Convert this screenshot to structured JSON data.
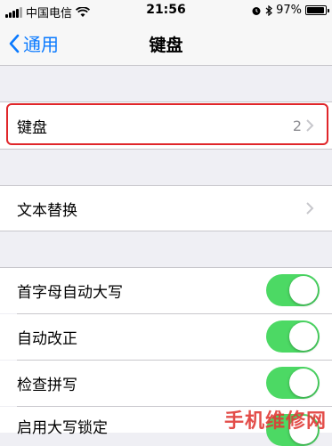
{
  "status_bar": {
    "carrier": "中国电信",
    "time": "21:56",
    "battery_percent": "97%",
    "battery_level": 0.97
  },
  "nav": {
    "back_label": "通用",
    "title": "键盘"
  },
  "rows": {
    "keyboards": {
      "label": "键盘",
      "value": "2"
    },
    "text_replacement": {
      "label": "文本替换"
    }
  },
  "toggles": [
    {
      "label": "首字母自动大写",
      "on": true
    },
    {
      "label": "自动改正",
      "on": true
    },
    {
      "label": "检查拼写",
      "on": true
    },
    {
      "label": "启用大写锁定",
      "on": true
    }
  ],
  "watermark": "手机维修网",
  "colors": {
    "accent": "#0a7aff",
    "toggle_on": "#4cd964",
    "highlight": "#e0262a",
    "background": "#efeff4"
  },
  "icons": [
    "wifi-icon",
    "alarm-icon",
    "bluetooth-icon",
    "battery-icon",
    "back-chevron-icon",
    "chevron-right-icon"
  ]
}
